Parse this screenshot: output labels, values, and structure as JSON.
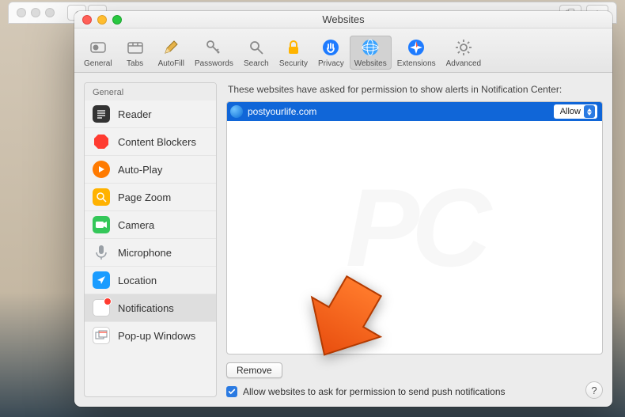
{
  "outer": {
    "plus": "+",
    "back": "‹",
    "fwd": "›"
  },
  "window": {
    "title": "Websites"
  },
  "toolbar": [
    {
      "id": "general",
      "label": "General"
    },
    {
      "id": "tabs",
      "label": "Tabs"
    },
    {
      "id": "autofill",
      "label": "AutoFill"
    },
    {
      "id": "passwords",
      "label": "Passwords"
    },
    {
      "id": "search",
      "label": "Search"
    },
    {
      "id": "security",
      "label": "Security"
    },
    {
      "id": "privacy",
      "label": "Privacy"
    },
    {
      "id": "websites",
      "label": "Websites"
    },
    {
      "id": "extensions",
      "label": "Extensions"
    },
    {
      "id": "advanced",
      "label": "Advanced"
    }
  ],
  "sidebar": {
    "header": "General",
    "items": [
      {
        "id": "reader",
        "label": "Reader"
      },
      {
        "id": "content-blockers",
        "label": "Content Blockers"
      },
      {
        "id": "auto-play",
        "label": "Auto-Play"
      },
      {
        "id": "page-zoom",
        "label": "Page Zoom"
      },
      {
        "id": "camera",
        "label": "Camera"
      },
      {
        "id": "microphone",
        "label": "Microphone"
      },
      {
        "id": "location",
        "label": "Location"
      },
      {
        "id": "notifications",
        "label": "Notifications"
      },
      {
        "id": "popup",
        "label": "Pop-up Windows"
      }
    ]
  },
  "main": {
    "description": "These websites have asked for permission to show alerts in Notification Center:",
    "sites": [
      {
        "name": "postyourlife.com",
        "permission": "Allow"
      }
    ],
    "remove_label": "Remove",
    "checkbox_label": "Allow websites to ask for permission to send push notifications",
    "checkbox_checked": true,
    "help_label": "?"
  }
}
